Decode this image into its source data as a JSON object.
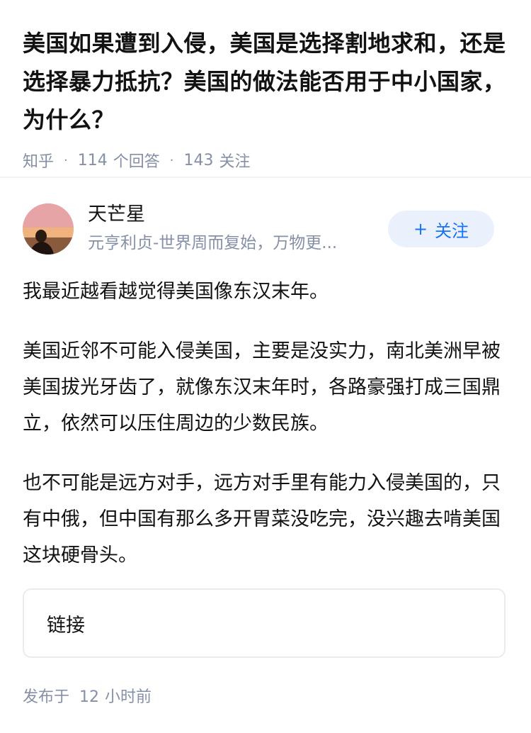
{
  "question": {
    "title": "美国如果遭到入侵，美国是选择割地求和，还是选择暴力抵抗？美国的做法能否用于中小国家，为什么？",
    "source": "知乎",
    "answer_count": "114",
    "answer_label": "个回答",
    "follow_count": "143",
    "follow_label": "关注"
  },
  "author": {
    "name": "天芒星",
    "bio": "元亨利贞-世界周而复始，万物更...",
    "follow_button": {
      "icon": "plus-icon",
      "label": "关注",
      "color": "#1772f6",
      "bg": "#eaf1fd"
    }
  },
  "answer": {
    "paragraphs": [
      "我最近越看越觉得美国像东汉末年。",
      "美国近邻不可能入侵美国，主要是没实力，南北美洲早被美国拔光牙齿了，就像东汉末年时，各路豪强打成三国鼎立，依然可以压住周边的少数民族。",
      "也不可能是远方对手，远方对手里有能力入侵美国的，只有中俄，但中国有那么多开胃菜没吃完，没兴趣去啃美国这块硬骨头。"
    ],
    "link_label": "链接",
    "publish_prefix": "发布于",
    "publish_time": "12",
    "publish_unit": "小时前"
  },
  "colors": {
    "meta": "#8590a6",
    "text": "#121212",
    "accent": "#1772f6"
  }
}
